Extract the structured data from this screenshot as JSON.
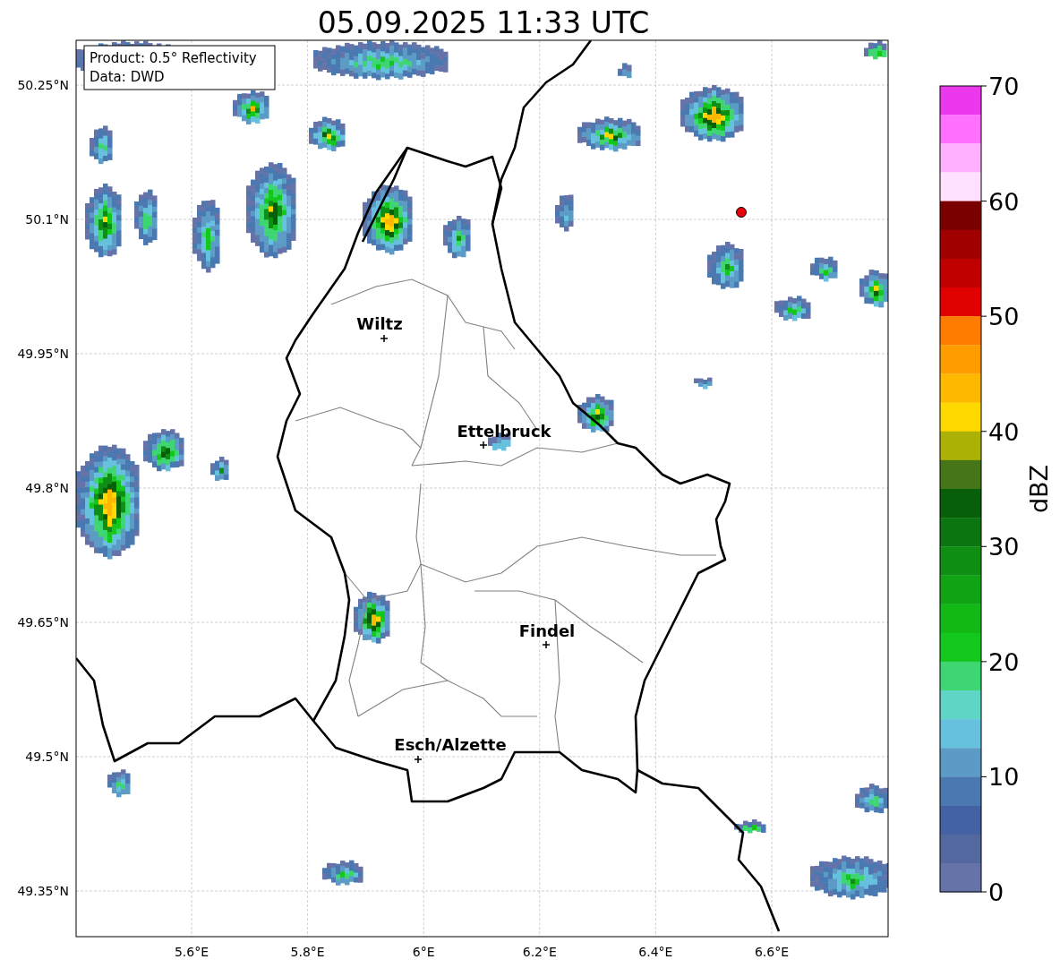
{
  "title": "05.09.2025 11:33 UTC",
  "info_box": [
    "Product: 0.5° Reflectivity",
    "Data: DWD"
  ],
  "map": {
    "cities": [
      {
        "name": "Wiltz"
      },
      {
        "name": "Ettelbruck"
      },
      {
        "name": "Findel"
      },
      {
        "name": "Esch/Alzette"
      }
    ],
    "yticks": [
      "50.25°N",
      "50.1°N",
      "49.95°N",
      "49.8°N",
      "49.65°N",
      "49.5°N",
      "49.35°N"
    ],
    "xticks": [
      "5.6°E",
      "5.8°E",
      "6°E",
      "6.2°E",
      "6.4°E",
      "6.6°E"
    ]
  },
  "colorbar": {
    "label": "dBZ",
    "ticks": [
      "70",
      "60",
      "50",
      "40",
      "30",
      "20",
      "10",
      "0"
    ],
    "bands": [
      {
        "color": "#ec38ec"
      },
      {
        "color": "#ff70ff"
      },
      {
        "color": "#ffb0ff"
      },
      {
        "color": "#ffe0ff"
      },
      {
        "color": "#7a0000"
      },
      {
        "color": "#a00000"
      },
      {
        "color": "#c00000"
      },
      {
        "color": "#e00000"
      },
      {
        "color": "#ff7c00"
      },
      {
        "color": "#ff9c00"
      },
      {
        "color": "#ffb800"
      },
      {
        "color": "#ffd800"
      },
      {
        "color": "#acb106"
      },
      {
        "color": "#457516"
      },
      {
        "color": "#075f0a"
      },
      {
        "color": "#0b7510"
      },
      {
        "color": "#0e8e12"
      },
      {
        "color": "#10a414"
      },
      {
        "color": "#12b816"
      },
      {
        "color": "#14c71c"
      },
      {
        "color": "#3dd672"
      },
      {
        "color": "#5fd5c5"
      },
      {
        "color": "#66c1de"
      },
      {
        "color": "#5b9bc6"
      },
      {
        "color": "#4a78b0"
      },
      {
        "color": "#4462a3"
      },
      {
        "color": "#52689e"
      },
      {
        "color": "#6573a8"
      }
    ]
  }
}
